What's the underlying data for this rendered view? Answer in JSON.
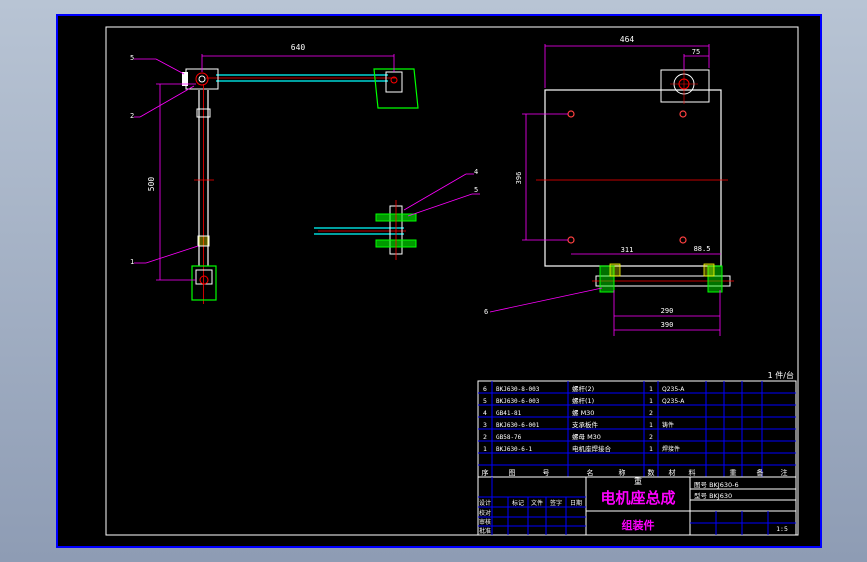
{
  "colors": {
    "background": "#000000",
    "frame": "#ffffff",
    "dimension": "#ff00ff",
    "centerline": "#ff0000",
    "part": "#00ff00",
    "shaft": "#00ffff",
    "title_block": "#0000ff",
    "hole": "#ff4040"
  },
  "dimensions": {
    "horizontal_arm": "640",
    "vertical_arm": "500",
    "plate_width": "464",
    "bracket_offset": "75",
    "plate_height": "396",
    "hole_spacing": "311",
    "hole_edge": "88.5",
    "rail_inner": "290",
    "rail_outer": "390"
  },
  "balloons": {
    "b5_top": "5",
    "b2_left": "2",
    "b1_left": "1",
    "b4_mid": "4",
    "b5_mid": "5",
    "b6_bottom": "6"
  },
  "sheet_info": "1 件/台",
  "parts_list": [
    {
      "seq": "6",
      "code": "BKJ630-8-003",
      "name": "螺杆(2)",
      "qty": "1",
      "material": "Q235-A"
    },
    {
      "seq": "5",
      "code": "BKJ630-6-003",
      "name": "螺杆(1)",
      "qty": "1",
      "material": "Q235-A"
    },
    {
      "seq": "4",
      "code": "GB41-81",
      "name": "螺 M30",
      "qty": "2",
      "material": ""
    },
    {
      "seq": "3",
      "code": "BKJ630-6-001",
      "name": "支承板件",
      "qty": "1",
      "material": "铸件"
    },
    {
      "seq": "2",
      "code": "GB58-76",
      "name": "螺母 M30",
      "qty": "2",
      "material": ""
    },
    {
      "seq": "1",
      "code": "BKJ630-6-1",
      "name": "电机座焊接合",
      "qty": "1",
      "material": "焊接件"
    }
  ],
  "header_row": [
    "序",
    "图",
    "号",
    "名",
    "称",
    "数",
    "材",
    "料",
    "重",
    "备",
    "注"
  ],
  "title": "电机座总成",
  "title_small": "重",
  "subtitle": "组装件",
  "drawing_number": "图号 BKJ630-6",
  "model_number": "型号 BKJ630",
  "scale": "1:5",
  "sign_rows": [
    "设计",
    "校对",
    "审核",
    "批准"
  ],
  "sign_labels": [
    "日期",
    "签字",
    "文件",
    "标记"
  ]
}
